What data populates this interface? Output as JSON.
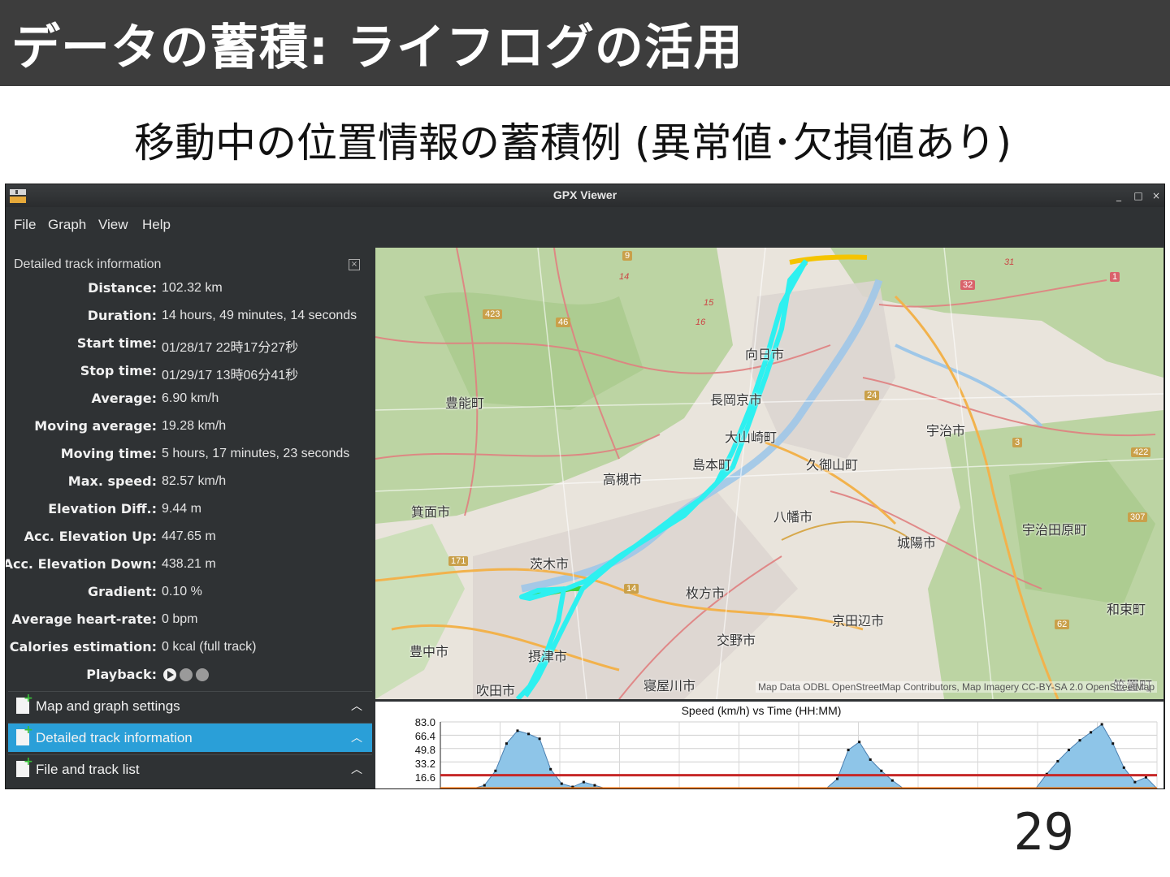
{
  "slide": {
    "title": "データの蓄積: ライフログの活用",
    "subtitle": "移動中の位置情報の蓄積例 (異常値･欠損値あり)",
    "page_number": "29"
  },
  "window": {
    "title": "GPX Viewer",
    "controls": [
      "_",
      "□",
      "×"
    ]
  },
  "menu": [
    "File",
    "Graph",
    "View",
    "Help"
  ],
  "panel": {
    "heading": "Detailed track information",
    "rows": [
      {
        "label": "Distance:",
        "value": "102.32 km"
      },
      {
        "label": "Duration:",
        "value": "14 hours, 49 minutes, 14 seconds"
      },
      {
        "label": "Start time:",
        "value": "01/28/17 22時17分27秒"
      },
      {
        "label": "Stop time:",
        "value": "01/29/17 13時06分41秒"
      },
      {
        "label": "Average:",
        "value": "6.90 km/h"
      },
      {
        "label": "Moving average:",
        "value": "19.28 km/h"
      },
      {
        "label": "Moving time:",
        "value": "5 hours, 17 minutes, 23 seconds"
      },
      {
        "label": "Max. speed:",
        "value": "82.57 km/h"
      },
      {
        "label": "Elevation Diff.:",
        "value": "9.44 m"
      },
      {
        "label": "Acc. Elevation Up:",
        "value": "447.65 m"
      },
      {
        "label": "Acc. Elevation Down:",
        "value": "438.21 m"
      },
      {
        "label": "Gradient:",
        "value": "0.10 %"
      },
      {
        "label": "Average heart-rate:",
        "value": "0 bpm"
      },
      {
        "label": "Calories estimation:",
        "value": "0 kcal (full track)"
      },
      {
        "label": "Playback:",
        "value": ""
      }
    ],
    "accordion": [
      {
        "label": "Map and graph settings",
        "active": false
      },
      {
        "label": "Detailed track information",
        "active": true
      },
      {
        "label": "File and track list",
        "active": false
      }
    ]
  },
  "map": {
    "attribution": "Map Data ODBL OpenStreetMap Contributors, Map Imagery CC-BY-SA 2.0 OpenStreetMap",
    "places": [
      "向日市",
      "長岡京市",
      "大山崎町",
      "島本町",
      "高槻市",
      "豊能町",
      "箕面市",
      "茨木市",
      "摂津市",
      "吹田市",
      "豊中市",
      "寝屋川市",
      "枚方市",
      "交野市",
      "八幡市",
      "久御山町",
      "宇治市",
      "城陽市",
      "宇治田原町",
      "京田辺市",
      "和束町",
      "笠置町"
    ],
    "road_numbers": [
      "9",
      "14",
      "423",
      "46",
      "15",
      "16",
      "24",
      "3",
      "422",
      "307",
      "171",
      "14",
      "62",
      "32",
      "1",
      "31"
    ],
    "track_colors": [
      "#2ef0f0",
      "#f5c400",
      "#3fd23f"
    ]
  },
  "graph": {
    "title": "Speed (km/h) vs Time (HH:MM)",
    "y_ticks": [
      "83.0",
      "66.4",
      "49.8",
      "33.2",
      "16.6"
    ]
  },
  "chart_data": {
    "type": "area",
    "title": "Speed (km/h) vs Time (HH:MM)",
    "ylabel": "Speed (km/h)",
    "ylim": [
      0,
      83.0
    ],
    "x": [
      0,
      3,
      4,
      5,
      6,
      7,
      8,
      9,
      10,
      11,
      12,
      13,
      14,
      15,
      18,
      19,
      20,
      22,
      23,
      24,
      35,
      36,
      37,
      38,
      39,
      40,
      41,
      42,
      43,
      54,
      55,
      56,
      57,
      58,
      59,
      60,
      61,
      62,
      63,
      64,
      65
    ],
    "values": [
      0,
      0,
      4,
      22,
      56,
      72,
      68,
      62,
      24,
      6,
      2,
      8,
      4,
      0,
      0,
      0,
      0,
      0,
      0,
      0,
      0,
      12,
      48,
      58,
      36,
      22,
      10,
      0,
      0,
      0,
      18,
      34,
      48,
      60,
      70,
      80,
      56,
      26,
      8,
      14,
      0
    ],
    "series": [
      {
        "name": "Speed",
        "color": "#8ec5e8"
      }
    ],
    "reference_lines": [
      {
        "value": 16.6,
        "color": "#c62828"
      },
      {
        "value": 0,
        "color": "#ef6c00"
      }
    ]
  }
}
